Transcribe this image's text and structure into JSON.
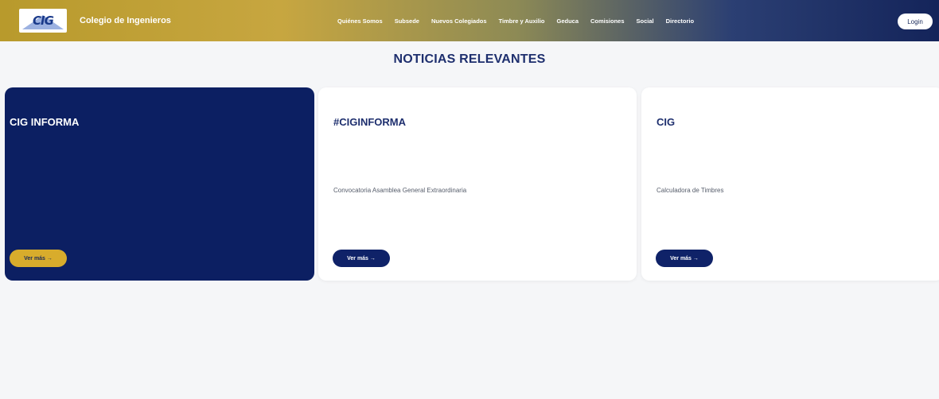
{
  "header": {
    "logo_text": "CIG",
    "brand_name": "Colegio de Ingenieros",
    "nav": [
      "Quiénes Somos",
      "Subsede",
      "Nuevos Colegiados",
      "Timbre y Auxilio",
      "Geduca",
      "Comisiones",
      "Social",
      "Directorio"
    ],
    "login_label": "Login"
  },
  "section": {
    "title": "NOTICIAS RELEVANTES"
  },
  "cards": [
    {
      "title": "CIG INFORMA",
      "description": "",
      "button_label": "Ver más →"
    },
    {
      "title": "#CIGINFORMA",
      "description": "Convocatoria Asamblea General Extraordinaria",
      "button_label": "Ver más →"
    },
    {
      "title": "CIG",
      "description": "Calculadora de Timbres",
      "button_label": "Ver más →"
    }
  ],
  "colors": {
    "navy": "#0c1f62",
    "gold": "#d8ac2c",
    "title_blue": "#1e2f6e",
    "page_bg": "#f5f6f8"
  }
}
